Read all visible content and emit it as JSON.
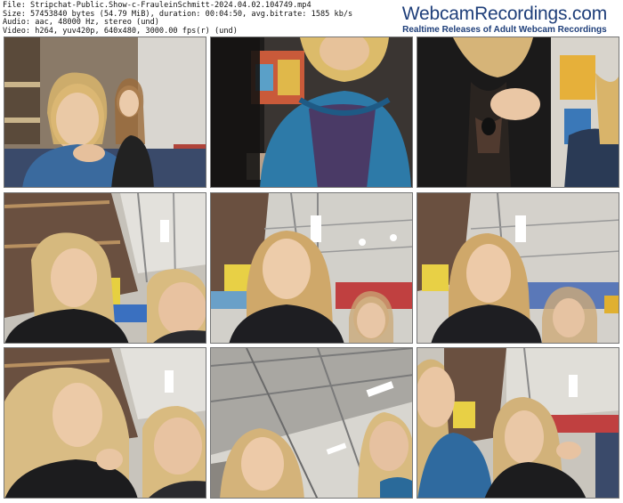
{
  "file_info": {
    "line1": "File: Stripchat-Public.Show-c-FrauleinSchmitt-2024.04.02.104749.mp4",
    "line2": "Size: 57453840 bytes (54.79 MiB), duration: 00:04:50, avg.bitrate: 1585 kb/s",
    "line3": "Audio: aac, 48000 Hz, stereo (und)",
    "line4": "Video: h264, yuv420p, 640x480, 3000.00 fps(r) (und)"
  },
  "logo": {
    "title": "WebcamRecordings.com",
    "subtitle": "Realtime Releases of Adult Webcam Recordings"
  },
  "thumbnails": [
    {
      "scene": "store-aisle-two-women"
    },
    {
      "scene": "woman-blue-jacket-shelves"
    },
    {
      "scene": "woman-black-top-hand"
    },
    {
      "scene": "ceiling-two-women"
    },
    {
      "scene": "ceiling-two-women"
    },
    {
      "scene": "ceiling-two-women"
    },
    {
      "scene": "ceiling-two-women-smiling"
    },
    {
      "scene": "ceiling-low-angle"
    },
    {
      "scene": "shelves-two-women-gesture"
    }
  ]
}
